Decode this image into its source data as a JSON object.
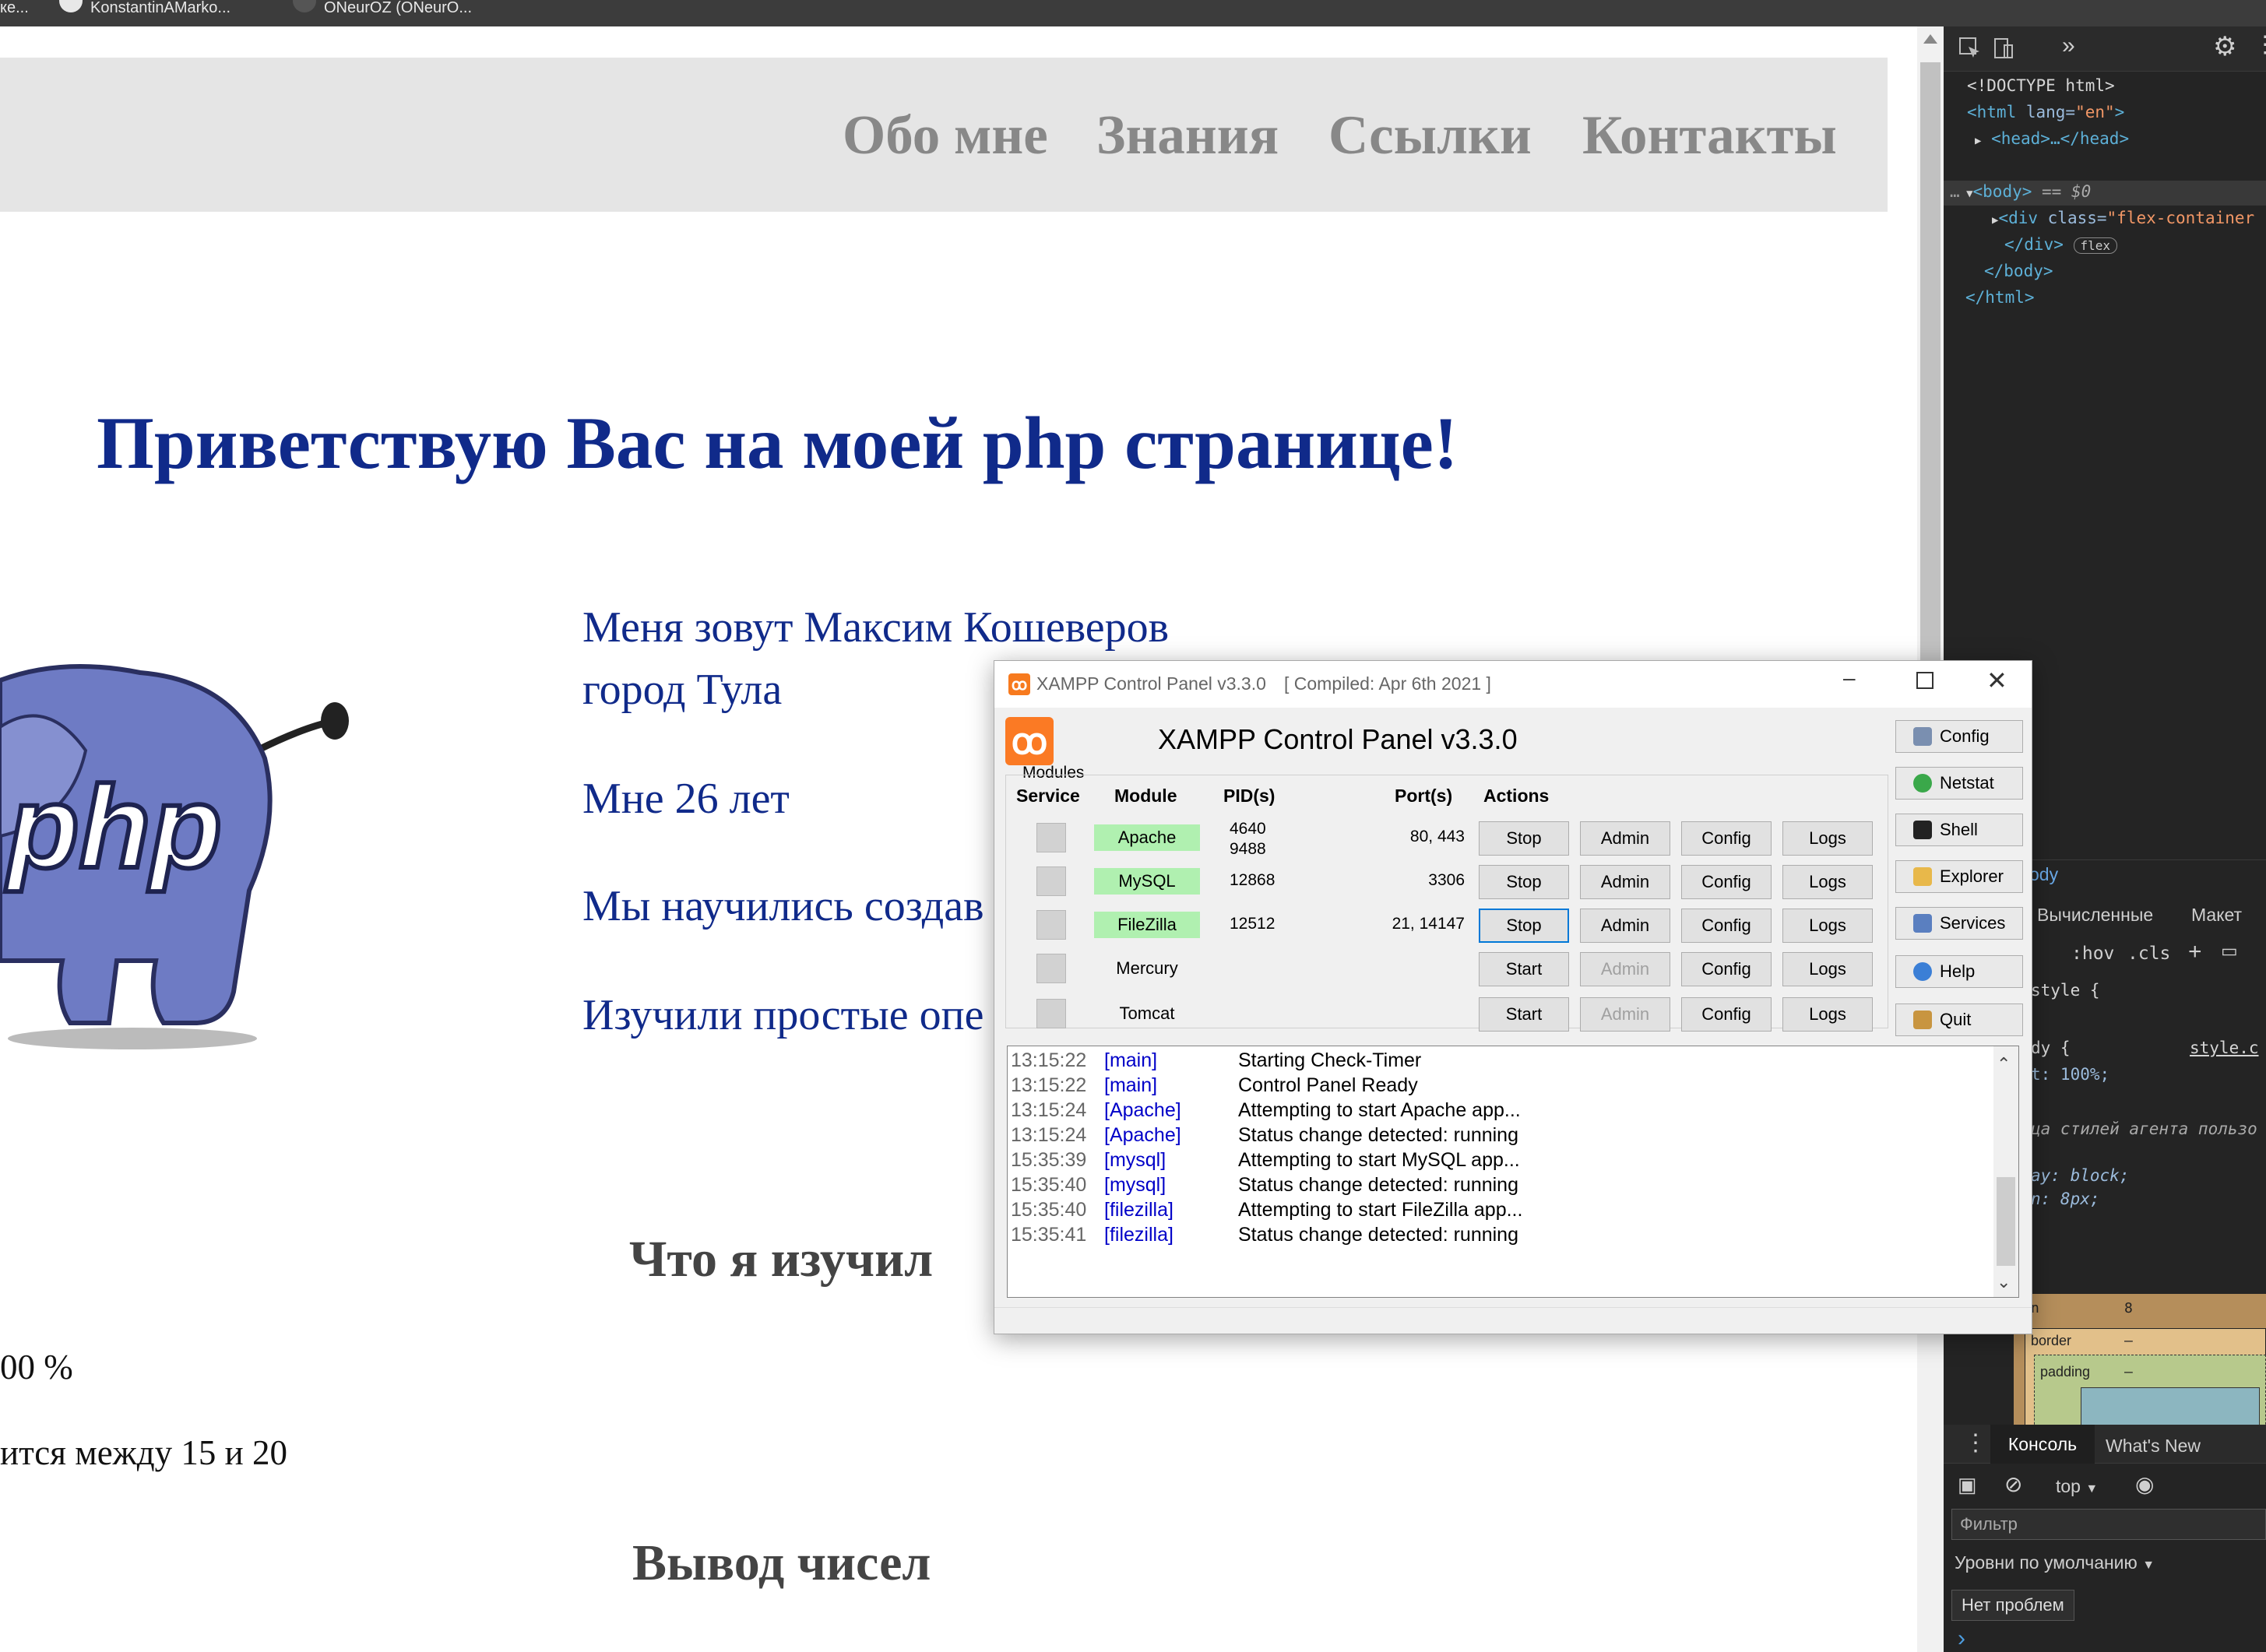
{
  "browser_tabs": [
    {
      "label": "ке..."
    },
    {
      "label": "KonstantinAMarko..."
    },
    {
      "label": "ONeurOZ (ONeurO..."
    }
  ],
  "page": {
    "nav": [
      "Обо мне",
      "Знания",
      "Ссылки",
      "Контакты"
    ],
    "heading": "Приветствую Вас на моей php странице!",
    "logo_text": "php",
    "name_line": "Меня зовут Максим Кошеверов",
    "city_line": "город Тула",
    "age_line": "Мне 26 лет",
    "learned_line": "Мы научились создав",
    "studied_line": "Изучили простые опе",
    "section1": "Что я изучил",
    "percent_text": "00 %",
    "between_text": "ится между 15 и 20",
    "section2": "Вывод чисел"
  },
  "devtools": {
    "code": {
      "doctype": "<!DOCTYPE html>",
      "html_open_tag": "<html",
      "html_lang_attr": " lang=",
      "html_lang_val": "\"en\"",
      "html_close_bracket": ">",
      "head": "<head>…</head>",
      "body_tag": "<body>",
      "body_eq": " == $0",
      "div_open": "<div",
      "div_class_attr": " class=",
      "div_class_val": "\"flex-container",
      "div_close": "</div>",
      "flex_badge": "flex",
      "body_close": "</body>",
      "html_close": "</html>"
    },
    "breadcrumb_partial": "ody",
    "style_tabs": [
      "Вычисленные",
      "Макет"
    ],
    "hov": ":hov",
    "cls": ".cls",
    "rules": {
      "style_open": "style {",
      "body_rule": "dy {",
      "style_link": "style.c",
      "prop1": "t: 100%;",
      "agent_comment": "ца стилей агента пользо",
      "prop2": "ay: block;",
      "prop3": "n: 8px;"
    },
    "boxmodel": {
      "margin_letter": "n",
      "margin_value": "8",
      "border_label": "border",
      "border_value": "–",
      "padding_label": "padding",
      "padding_value": "–"
    },
    "console_tabs": [
      "Консоль",
      "What's New"
    ],
    "context": "top",
    "filter_placeholder": "Фильтр",
    "levels": "Уровни по умолчанию",
    "no_issues": "Нет проблем",
    "prompt": "›"
  },
  "xampp": {
    "window_title": "XAMPP Control Panel v3.3.0",
    "compiled": "[ Compiled: Apr 6th 2021 ]",
    "header": "XAMPP Control Panel v3.3.0",
    "modules_label": "Modules",
    "columns": [
      "Service",
      "Module",
      "PID(s)",
      "Port(s)",
      "Actions"
    ],
    "modules": [
      {
        "name": "Apache",
        "running": true,
        "pid": "4640",
        "pid2": "9488",
        "ports": "80, 443",
        "action": "Stop",
        "admin": "Admin",
        "config": "Config",
        "logs": "Logs"
      },
      {
        "name": "MySQL",
        "running": true,
        "pid": "12868",
        "pid2": "",
        "ports": "3306",
        "action": "Stop",
        "admin": "Admin",
        "config": "Config",
        "logs": "Logs"
      },
      {
        "name": "FileZilla",
        "running": true,
        "pid": "12512",
        "pid2": "",
        "ports": "21, 14147",
        "action": "Stop",
        "admin": "Admin",
        "config": "Config",
        "logs": "Logs"
      },
      {
        "name": "Mercury",
        "running": false,
        "pid": "",
        "pid2": "",
        "ports": "",
        "action": "Start",
        "admin": "Admin",
        "config": "Config",
        "logs": "Logs"
      },
      {
        "name": "Tomcat",
        "running": false,
        "pid": "",
        "pid2": "",
        "ports": "",
        "action": "Start",
        "admin": "Admin",
        "config": "Config",
        "logs": "Logs"
      }
    ],
    "side_buttons": [
      {
        "label": "Config",
        "icon": "wrench-icon",
        "color": "#7a8fb0"
      },
      {
        "label": "Netstat",
        "icon": "globe-icon",
        "color": "#3aa84a"
      },
      {
        "label": "Shell",
        "icon": "terminal-icon",
        "color": "#222222"
      },
      {
        "label": "Explorer",
        "icon": "folder-icon",
        "color": "#e8b84a"
      },
      {
        "label": "Services",
        "icon": "services-icon",
        "color": "#5a7fc0"
      },
      {
        "label": "Help",
        "icon": "help-icon",
        "color": "#3b7fd6"
      },
      {
        "label": "Quit",
        "icon": "door-icon",
        "color": "#c89540"
      }
    ],
    "log": [
      {
        "time": "13:15:22",
        "src": "[main]",
        "msg": "Starting Check-Timer"
      },
      {
        "time": "13:15:22",
        "src": "[main]",
        "msg": "Control Panel Ready"
      },
      {
        "time": "13:15:24",
        "src": "[Apache]",
        "msg": "Attempting to start Apache app..."
      },
      {
        "time": "13:15:24",
        "src": "[Apache]",
        "msg": "Status change detected: running"
      },
      {
        "time": "15:35:39",
        "src": "[mysql]",
        "msg": "Attempting to start MySQL app..."
      },
      {
        "time": "15:35:40",
        "src": "[mysql]",
        "msg": "Status change detected: running"
      },
      {
        "time": "15:35:40",
        "src": "[filezilla]",
        "msg": "Attempting to start FileZilla app..."
      },
      {
        "time": "15:35:41",
        "src": "[filezilla]",
        "msg": "Status change detected: running"
      }
    ]
  }
}
